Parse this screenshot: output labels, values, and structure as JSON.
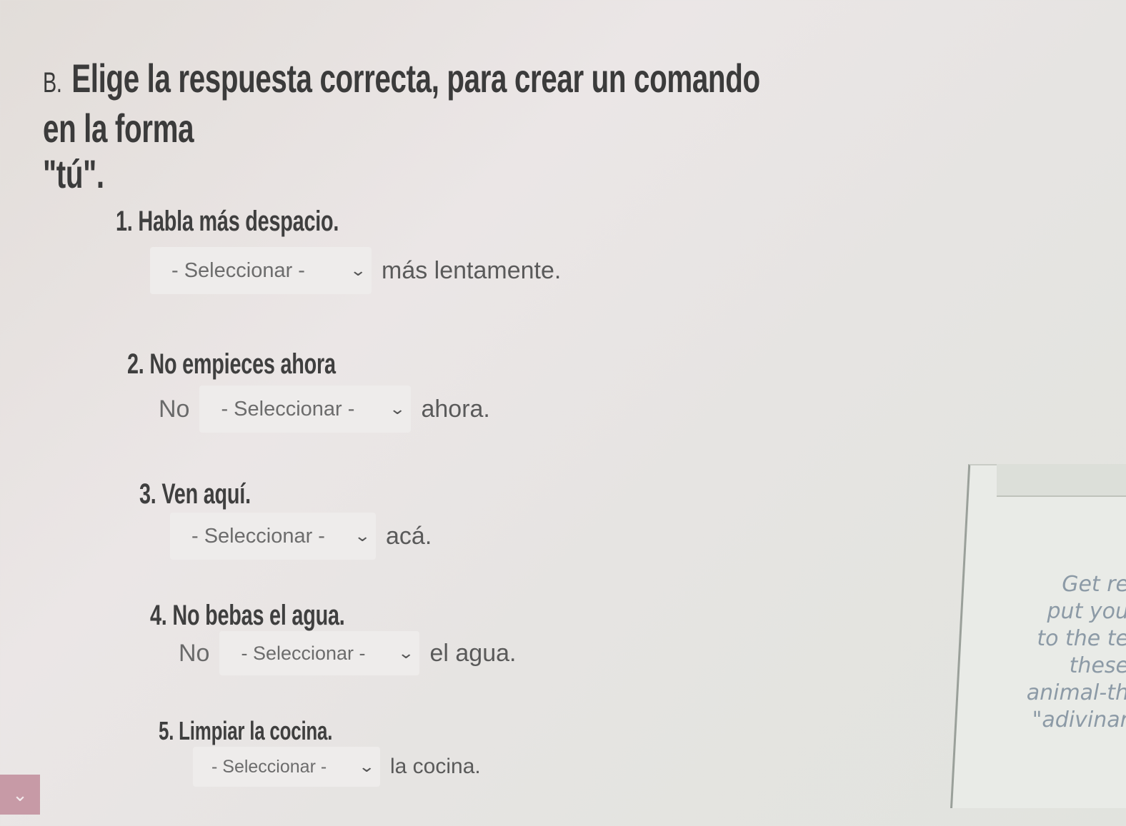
{
  "section": {
    "letter": "B.",
    "title_line1": "Elige la respuesta correcta, para crear un comando en la forma",
    "title_line2": "\"tú\"."
  },
  "items": [
    {
      "prompt": "1. Habla más despacio.",
      "prefix": "",
      "select_value": "- Seleccionar -",
      "suffix": "más lentamente."
    },
    {
      "prompt": "2. No empieces ahora",
      "prefix": "No",
      "select_value": "- Seleccionar -",
      "suffix": "ahora."
    },
    {
      "prompt": "3. Ven aquí.",
      "prefix": "",
      "select_value": "- Seleccionar -",
      "suffix": "acá."
    },
    {
      "prompt": "4. No bebas el agua.",
      "prefix": "No",
      "select_value": "- Seleccionar -",
      "suffix": "el agua."
    },
    {
      "prompt": "5. Limpiar la cocina.",
      "prefix": "",
      "select_value": "- Seleccionar -",
      "suffix": "la cocina."
    }
  ],
  "side_panel": {
    "lines": [
      "Get re",
      "put you",
      "to the te",
      "these",
      "animal-th",
      "\"adivinar"
    ]
  },
  "icons": {
    "select_chevron": "chevron-down-icon",
    "corner_widget": "chevron-down-icon"
  },
  "colors": {
    "select_background": "#eeeceb",
    "side_text": "#8c9aa6",
    "corner_widget": "#c79aa6"
  }
}
